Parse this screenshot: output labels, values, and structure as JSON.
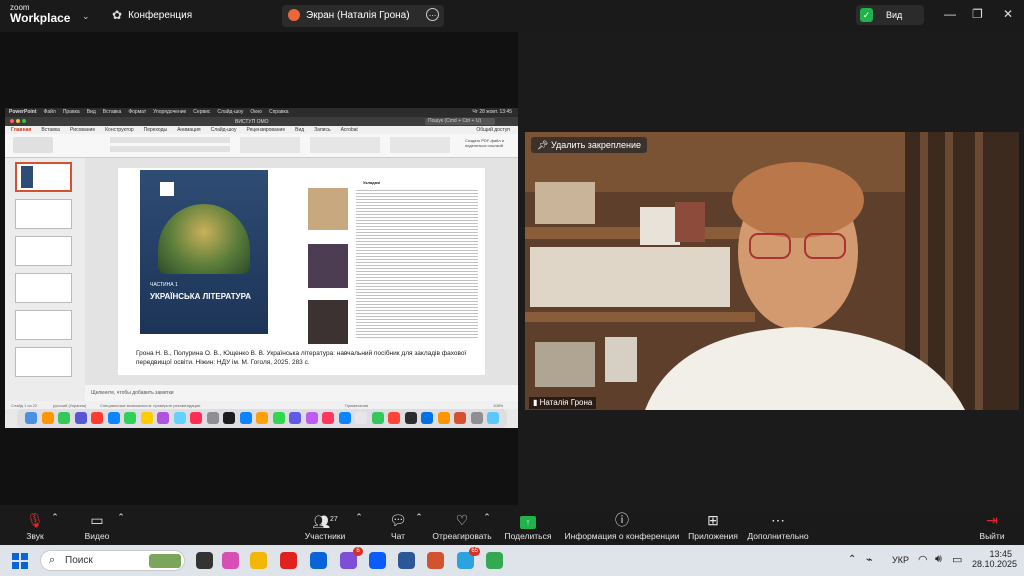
{
  "top_bar": {
    "logo_line1": "zoom",
    "logo_line2": "Workplace",
    "conference_label": "Конференция",
    "share_label": "Экран (Наталія Грона)",
    "view_label": "Вид"
  },
  "shared_screen": {
    "app_menu": [
      "PowerPoint",
      "Файл",
      "Правка",
      "Вид",
      "Вставка",
      "Формат",
      "Упорядочение",
      "Сервис",
      "Слайд-шоу",
      "Окно",
      "Справка"
    ],
    "clock": "Чт 28 жовт. 13:45",
    "doc_title": "ВИСТУП ОМО",
    "search_placeholder": "Пошук (Cmd + Ctrl + U)",
    "ribbon_tabs": [
      "Главная",
      "Вставка",
      "Рисование",
      "Конструктор",
      "Переходы",
      "Анимация",
      "Слайд-шоу",
      "Рецензирование",
      "Вид",
      "Запись",
      "Acrobat"
    ],
    "share_btn": "Общий доступ",
    "ribbon_right": "Создать PDF-файл и поделиться ссылкой",
    "book_part": "ЧАСТИНА 1",
    "book_title": "УКРАЇНСЬКА ЛІТЕРАТУРА",
    "citation": "Грона Н. В., Полурина О. В., Ющенко В. В. Українська література: навчальний посібник для закладів фахової передвищої освіти. Ніжин: НДУ ім. М. Гоголя, 2025. 283 с.",
    "authors_heading": "Укладачі",
    "notes_hint": "Щелкните, чтобы добавить заметки",
    "status_left": "Слайд 1 из 22",
    "status_lang": "русский (Украина)",
    "status_access": "Специальные возможности: проверьте рекомендации",
    "status_notes": "Примечания",
    "status_comments": "Примечания",
    "zoom_level": "108%"
  },
  "video": {
    "unpin_label": "Удалить закрепление",
    "participant_name": "Наталія Грона"
  },
  "toolbar": {
    "audio": "Звук",
    "video": "Видео",
    "participants": "Участники",
    "participants_count": "27",
    "chat": "Чат",
    "react": "Отреагировать",
    "share": "Поделиться",
    "info": "Информация о конференции",
    "apps": "Приложения",
    "more": "Дополнительно",
    "leave": "Выйти"
  },
  "taskbar": {
    "search_placeholder": "Поиск",
    "lang": "УКР",
    "time": "13:45",
    "date": "28.10.2025",
    "badge_viber": "6",
    "badge_telegram": "65"
  },
  "colors": {
    "zoom_blue": "#0b5cff",
    "share_green": "#1fb34a",
    "leave_red": "#e02828"
  }
}
